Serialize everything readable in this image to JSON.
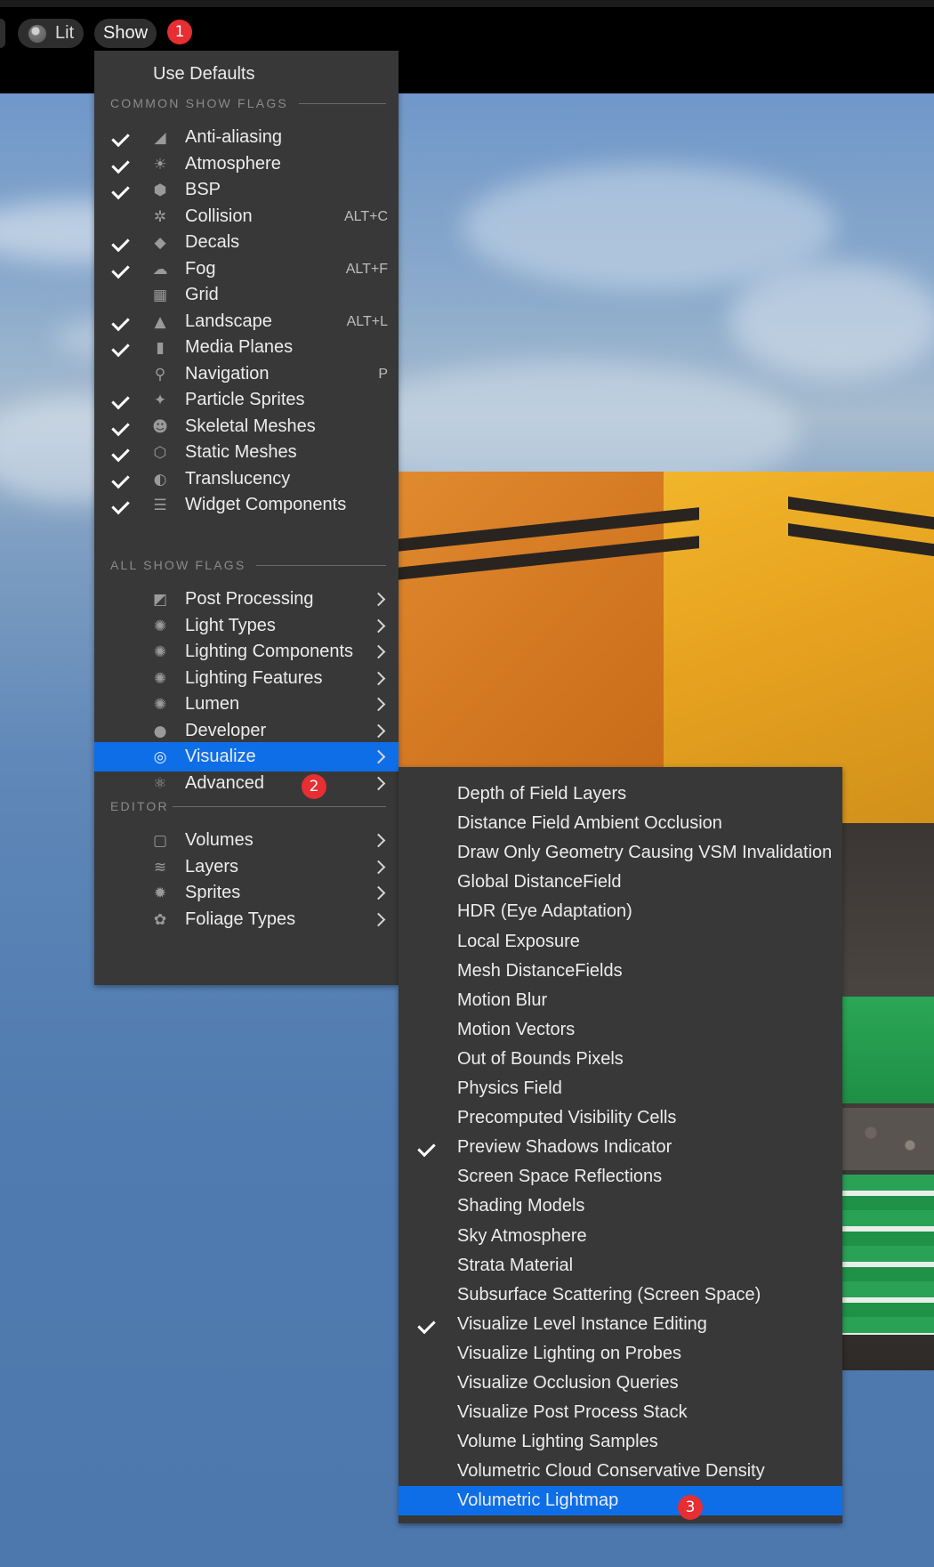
{
  "toolbar": {
    "lit_label": "Lit",
    "show_label": "Show"
  },
  "badges": {
    "b1": "1",
    "b2": "2",
    "b3": "3"
  },
  "show_menu": {
    "use_defaults": "Use Defaults",
    "common_header": "COMMON SHOW FLAGS",
    "common_items": [
      {
        "label": "Anti-aliasing",
        "checked": true,
        "icon": "anti-aliasing-icon",
        "shortcut": ""
      },
      {
        "label": "Atmosphere",
        "checked": true,
        "icon": "atmosphere-icon",
        "shortcut": ""
      },
      {
        "label": "BSP",
        "checked": true,
        "icon": "bsp-icon",
        "shortcut": ""
      },
      {
        "label": "Collision",
        "checked": false,
        "icon": "collision-icon",
        "shortcut": "ALT+C"
      },
      {
        "label": "Decals",
        "checked": true,
        "icon": "decals-icon",
        "shortcut": ""
      },
      {
        "label": "Fog",
        "checked": true,
        "icon": "fog-icon",
        "shortcut": "ALT+F"
      },
      {
        "label": "Grid",
        "checked": false,
        "icon": "grid-icon",
        "shortcut": ""
      },
      {
        "label": "Landscape",
        "checked": true,
        "icon": "landscape-icon",
        "shortcut": "ALT+L"
      },
      {
        "label": "Media Planes",
        "checked": true,
        "icon": "media-planes-icon",
        "shortcut": ""
      },
      {
        "label": "Navigation",
        "checked": false,
        "icon": "navigation-pin-icon",
        "shortcut": "P"
      },
      {
        "label": "Particle Sprites",
        "checked": true,
        "icon": "particle-sprites-icon",
        "shortcut": ""
      },
      {
        "label": "Skeletal Meshes",
        "checked": true,
        "icon": "skeletal-meshes-icon",
        "shortcut": ""
      },
      {
        "label": "Static Meshes",
        "checked": true,
        "icon": "static-meshes-icon",
        "shortcut": ""
      },
      {
        "label": "Translucency",
        "checked": true,
        "icon": "translucency-icon",
        "shortcut": ""
      },
      {
        "label": "Widget Components",
        "checked": true,
        "icon": "widget-components-icon",
        "shortcut": ""
      }
    ],
    "all_header": "ALL SHOW FLAGS",
    "all_items": [
      {
        "label": "Post Processing",
        "icon": "post-processing-icon",
        "selected": false
      },
      {
        "label": "Light Types",
        "icon": "light-types-icon",
        "selected": false
      },
      {
        "label": "Lighting Components",
        "icon": "lighting-components-icon",
        "selected": false
      },
      {
        "label": "Lighting Features",
        "icon": "lighting-features-icon",
        "selected": false
      },
      {
        "label": "Lumen",
        "icon": "lumen-icon",
        "selected": false
      },
      {
        "label": "Developer",
        "icon": "developer-icon",
        "selected": false
      },
      {
        "label": "Visualize",
        "icon": "visualize-icon",
        "selected": true
      },
      {
        "label": "Advanced",
        "icon": "advanced-atom-icon",
        "selected": false
      }
    ],
    "editor_header": "EDITOR",
    "editor_items": [
      {
        "label": "Volumes",
        "icon": "volumes-icon"
      },
      {
        "label": "Layers",
        "icon": "layers-icon"
      },
      {
        "label": "Sprites",
        "icon": "sprites-icon"
      },
      {
        "label": "Foliage Types",
        "icon": "foliage-types-icon"
      }
    ]
  },
  "visualize_menu": {
    "items": [
      {
        "label": "Depth of Field Layers",
        "checked": false,
        "selected": false
      },
      {
        "label": "Distance Field Ambient Occlusion",
        "checked": false,
        "selected": false
      },
      {
        "label": "Draw Only Geometry Causing VSM Invalidation",
        "checked": false,
        "selected": false
      },
      {
        "label": "Global DistanceField",
        "checked": false,
        "selected": false
      },
      {
        "label": "HDR (Eye Adaptation)",
        "checked": false,
        "selected": false
      },
      {
        "label": "Local Exposure",
        "checked": false,
        "selected": false
      },
      {
        "label": "Mesh DistanceFields",
        "checked": false,
        "selected": false
      },
      {
        "label": "Motion Blur",
        "checked": false,
        "selected": false
      },
      {
        "label": "Motion Vectors",
        "checked": false,
        "selected": false
      },
      {
        "label": "Out of Bounds Pixels",
        "checked": false,
        "selected": false
      },
      {
        "label": "Physics Field",
        "checked": false,
        "selected": false
      },
      {
        "label": "Precomputed Visibility Cells",
        "checked": false,
        "selected": false
      },
      {
        "label": "Preview Shadows Indicator",
        "checked": true,
        "selected": false
      },
      {
        "label": "Screen Space Reflections",
        "checked": false,
        "selected": false
      },
      {
        "label": "Shading Models",
        "checked": false,
        "selected": false
      },
      {
        "label": "Sky Atmosphere",
        "checked": false,
        "selected": false
      },
      {
        "label": "Strata Material",
        "checked": false,
        "selected": false
      },
      {
        "label": "Subsurface Scattering (Screen Space)",
        "checked": false,
        "selected": false
      },
      {
        "label": "Visualize Level Instance Editing",
        "checked": true,
        "selected": false
      },
      {
        "label": "Visualize Lighting on Probes",
        "checked": false,
        "selected": false
      },
      {
        "label": "Visualize Occlusion Queries",
        "checked": false,
        "selected": false
      },
      {
        "label": "Visualize Post Process Stack",
        "checked": false,
        "selected": false
      },
      {
        "label": "Volume Lighting Samples",
        "checked": false,
        "selected": false
      },
      {
        "label": "Volumetric Cloud Conservative Density",
        "checked": false,
        "selected": false
      },
      {
        "label": "Volumetric Lightmap",
        "checked": false,
        "selected": true
      }
    ]
  },
  "colors": {
    "menu_bg": "#383838",
    "selection": "#0e6ee8",
    "badge": "#e62e33"
  }
}
